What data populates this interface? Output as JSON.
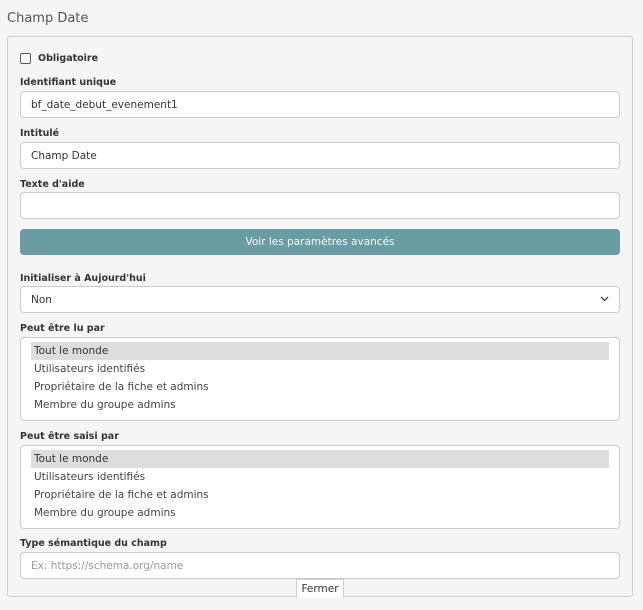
{
  "panel": {
    "title": "Champ Date"
  },
  "required": {
    "label": "Obligatoire",
    "checked": false
  },
  "identifier": {
    "label": "Identifiant unique",
    "value": "bf_date_debut_evenement1"
  },
  "title_field": {
    "label": "Intitulé",
    "value": "Champ Date"
  },
  "help": {
    "label": "Texte d'aide",
    "value": ""
  },
  "advanced_button": {
    "label": "Voir les paramètres avancés"
  },
  "init_today": {
    "label": "Initialiser à Aujourd'hui",
    "value": "Non"
  },
  "read_by": {
    "label": "Peut être lu par",
    "options": [
      "Tout le monde",
      "Utilisateurs identifiés",
      "Propriétaire de la fiche et admins",
      "Membre du groupe admins"
    ],
    "selected": 0
  },
  "write_by": {
    "label": "Peut être saisi par",
    "options": [
      "Tout le monde",
      "Utilisateurs identifiés",
      "Propriétaire de la fiche et admins",
      "Membre du groupe admins"
    ],
    "selected": 0
  },
  "semantic_type": {
    "label": "Type sémantique du champ",
    "placeholder": "Ex: https://schema.org/name",
    "value": ""
  },
  "close_button": {
    "label": "Fermer"
  },
  "colors": {
    "accent": "#6a9ca3",
    "selected_option": "#dddddd"
  }
}
